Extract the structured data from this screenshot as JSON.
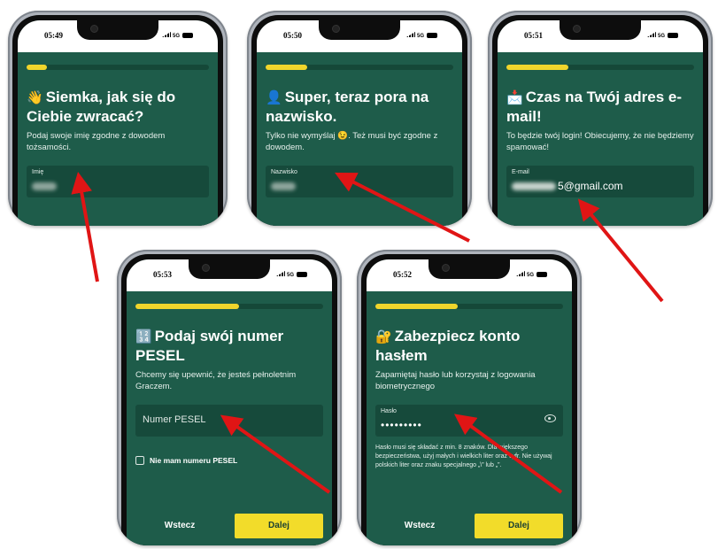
{
  "colors": {
    "screen_bg": "#1e5c4a",
    "field_bg": "#164a3b",
    "accent_yellow": "#f2dc2a",
    "arrow_red": "#e01515"
  },
  "phones": [
    {
      "time": "05:49",
      "network": "5G",
      "progress": 0.11,
      "title_emoji": "👋",
      "title": "Siemka, jak się do Ciebie zwracać?",
      "subtitle": "Podaj swoje imię zgodne z dowodem tożsamości.",
      "field_label": "Imię",
      "field_icon": "blurred-value"
    },
    {
      "time": "05:50",
      "network": "5G",
      "progress": 0.22,
      "title_emoji": "👤",
      "title": "Super, teraz pora na nazwisko.",
      "subtitle": "Tylko nie wymyślaj 😉. Też musi być zgodne z dowodem.",
      "field_label": "Nazwisko",
      "field_icon": "blurred-value"
    },
    {
      "time": "05:51",
      "network": "5G",
      "progress": 0.33,
      "title_emoji": "📩",
      "title": "Czas na Twój adres e-mail!",
      "subtitle": "To będzie twój login! Obiecujemy, że nie będziemy spamować!",
      "field_label": "E-mail",
      "field_value": "5@gmail.com"
    },
    {
      "time": "05:53",
      "network": "5G",
      "progress": 0.55,
      "title_emoji": "🔢",
      "title": "Podaj swój numer PESEL",
      "subtitle": "Chcemy się upewnić, że jesteś pełnoletnim Graczem.",
      "field_placeholder": "Numer PESEL",
      "checkbox_label": "Nie mam numeru PESEL",
      "back_label": "Wstecz",
      "next_label": "Dalej"
    },
    {
      "time": "05:52",
      "network": "5G",
      "progress": 0.44,
      "title_emoji": "🔐",
      "title": "Zabezpiecz konto hasłem",
      "subtitle": "Zapamiętaj hasło lub korzystaj z logowania biometrycznego",
      "field_label": "Hasło",
      "field_value": "•••••••••",
      "hint": "Hasło musi się składać z min. 8 znaków. Dla większego bezpieczeństwa, użyj małych i wielkich liter oraz cyfr. Nie używaj polskich liter oraz znaku specjalnego „\\” lub „”.",
      "back_label": "Wstecz",
      "next_label": "Dalej"
    }
  ]
}
